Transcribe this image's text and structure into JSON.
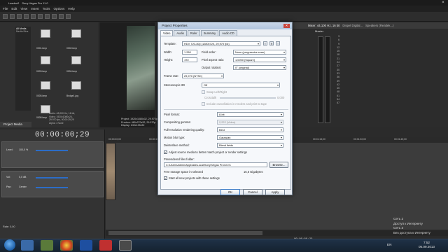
{
  "window": {
    "title_project": "Lasdoo2",
    "title_app": "Sony Vegas Pro 11.0"
  },
  "menubar": [
    "File",
    "Edit",
    "View",
    "Insert",
    "Tools",
    "Options",
    "Help"
  ],
  "media_panel": {
    "root": "All Media",
    "sub": "Media Bins",
    "files": [
      "0001.bmp",
      "0002.bmp",
      "0003.bmp",
      "0004.bmp",
      "0005.bmp",
      "0006.bmp",
      "0007.bmp",
      "Bridge1.jpg",
      "0008.bmp"
    ],
    "info_lines": [
      "Audio: 48,000 Hz, 16 bit,",
      "Video: 1920x1080x24,",
      "29.970 fps, 00:00:29;29",
      "Alpha = None"
    ],
    "tab": "Project Media"
  },
  "preview": {
    "info_lines": [
      "Project: 1920x1080x32, 29.970p",
      "Preview: 480x270x32, 29.970p",
      "Display: 240x135x32"
    ]
  },
  "mixer": {
    "title": "Mixer: 44,100 Hz, 16 bit",
    "device": "Speakers (Realtek...)",
    "device2": "Dispel Digital...",
    "master": "Master",
    "scale": [
      "3",
      "6",
      "9",
      "12",
      "15",
      "18",
      "21",
      "24",
      "27",
      "30",
      "33",
      "36",
      "39",
      "42",
      "45",
      "48",
      "51",
      "54",
      "57"
    ]
  },
  "timeline": {
    "timecode": "00:00:00;29",
    "ruler": [
      "00:00:00;00",
      "00:00:15;00",
      "00:00:30;00",
      "00:00:45;00",
      "00:01:00;00",
      "00:01:15;00",
      "00:01:30;00",
      "00:01:45;00"
    ],
    "track1": {
      "level_label": "Level:",
      "level": "100,0 %"
    },
    "track2": {
      "vol_label": "Vol:",
      "vol": "0,0 dB",
      "pan_label": "Pan:",
      "pan": "Center"
    },
    "rate": "Rate: 0,00",
    "status_time": "00:00:00;29"
  },
  "dialog": {
    "title": "Project Properties",
    "close": "✕",
    "tabs": [
      "Video",
      "Audio",
      "Ruler",
      "Summary",
      "Audio CD"
    ],
    "template_label": "Template:",
    "template_value": "HDV 720-30p (1280x720, 29,970 fps)",
    "width_label": "Width:",
    "width": "1 280",
    "field_order_label": "Field order:",
    "field_order": "None (progressive scan)",
    "height_label": "Height:",
    "height": "720",
    "pixel_aspect_label": "Pixel aspect ratio:",
    "pixel_aspect": "1,0000 (Square)",
    "output_rotation_label": "Output rotation:",
    "output_rotation": "0° (original)",
    "frame_rate_label": "Frame rate:",
    "frame_rate": "29,970 (NTSC)",
    "stereo_label": "Stereoscopic 3D",
    "stereo_mode": "Off",
    "swap_label": "Swap Left/Right",
    "crosstalk_label": "Crosstalk",
    "crosstalk_value": "0,000",
    "include_cancel_label": "Include cancellation in renders and print to tape",
    "pixel_format_label": "Pixel format:",
    "pixel_format": "8-bit",
    "compositing_gamma_label": "Compositing gamma:",
    "compositing_gamma": "2,222 (Video)",
    "full_res_label": "Full-resolution rendering quality:",
    "full_res": "Best",
    "motion_blur_label": "Motion blur type:",
    "motion_blur": "Gaussian",
    "deinterlace_label": "Deinterlace method:",
    "deinterlace": "Blend fields",
    "adjust_label": "Adjust source media to better match project or render settings",
    "prerender_label": "Prerendered files folder:",
    "prerender_path": "C:\\Users\\Admin\\AppData\\Local\\Sony\\Vegas Pro\\10.0\\",
    "browse_label": "Browse...",
    "free_storage_label": "Free storage space in selected",
    "free_storage": "16,5 Gigabytes",
    "start_all_label": "Start all new projects with these settings",
    "ok_label": "OK",
    "cancel_label": "Cancel",
    "apply_label": "Apply"
  },
  "notifications": [
    "Сеть 2",
    "Доступ к Интернету",
    "Сеть 3",
    "Без доступа к Интернету"
  ],
  "taskbar": {
    "lang": "EN",
    "time": "7:52",
    "date": "05.09.2013"
  }
}
